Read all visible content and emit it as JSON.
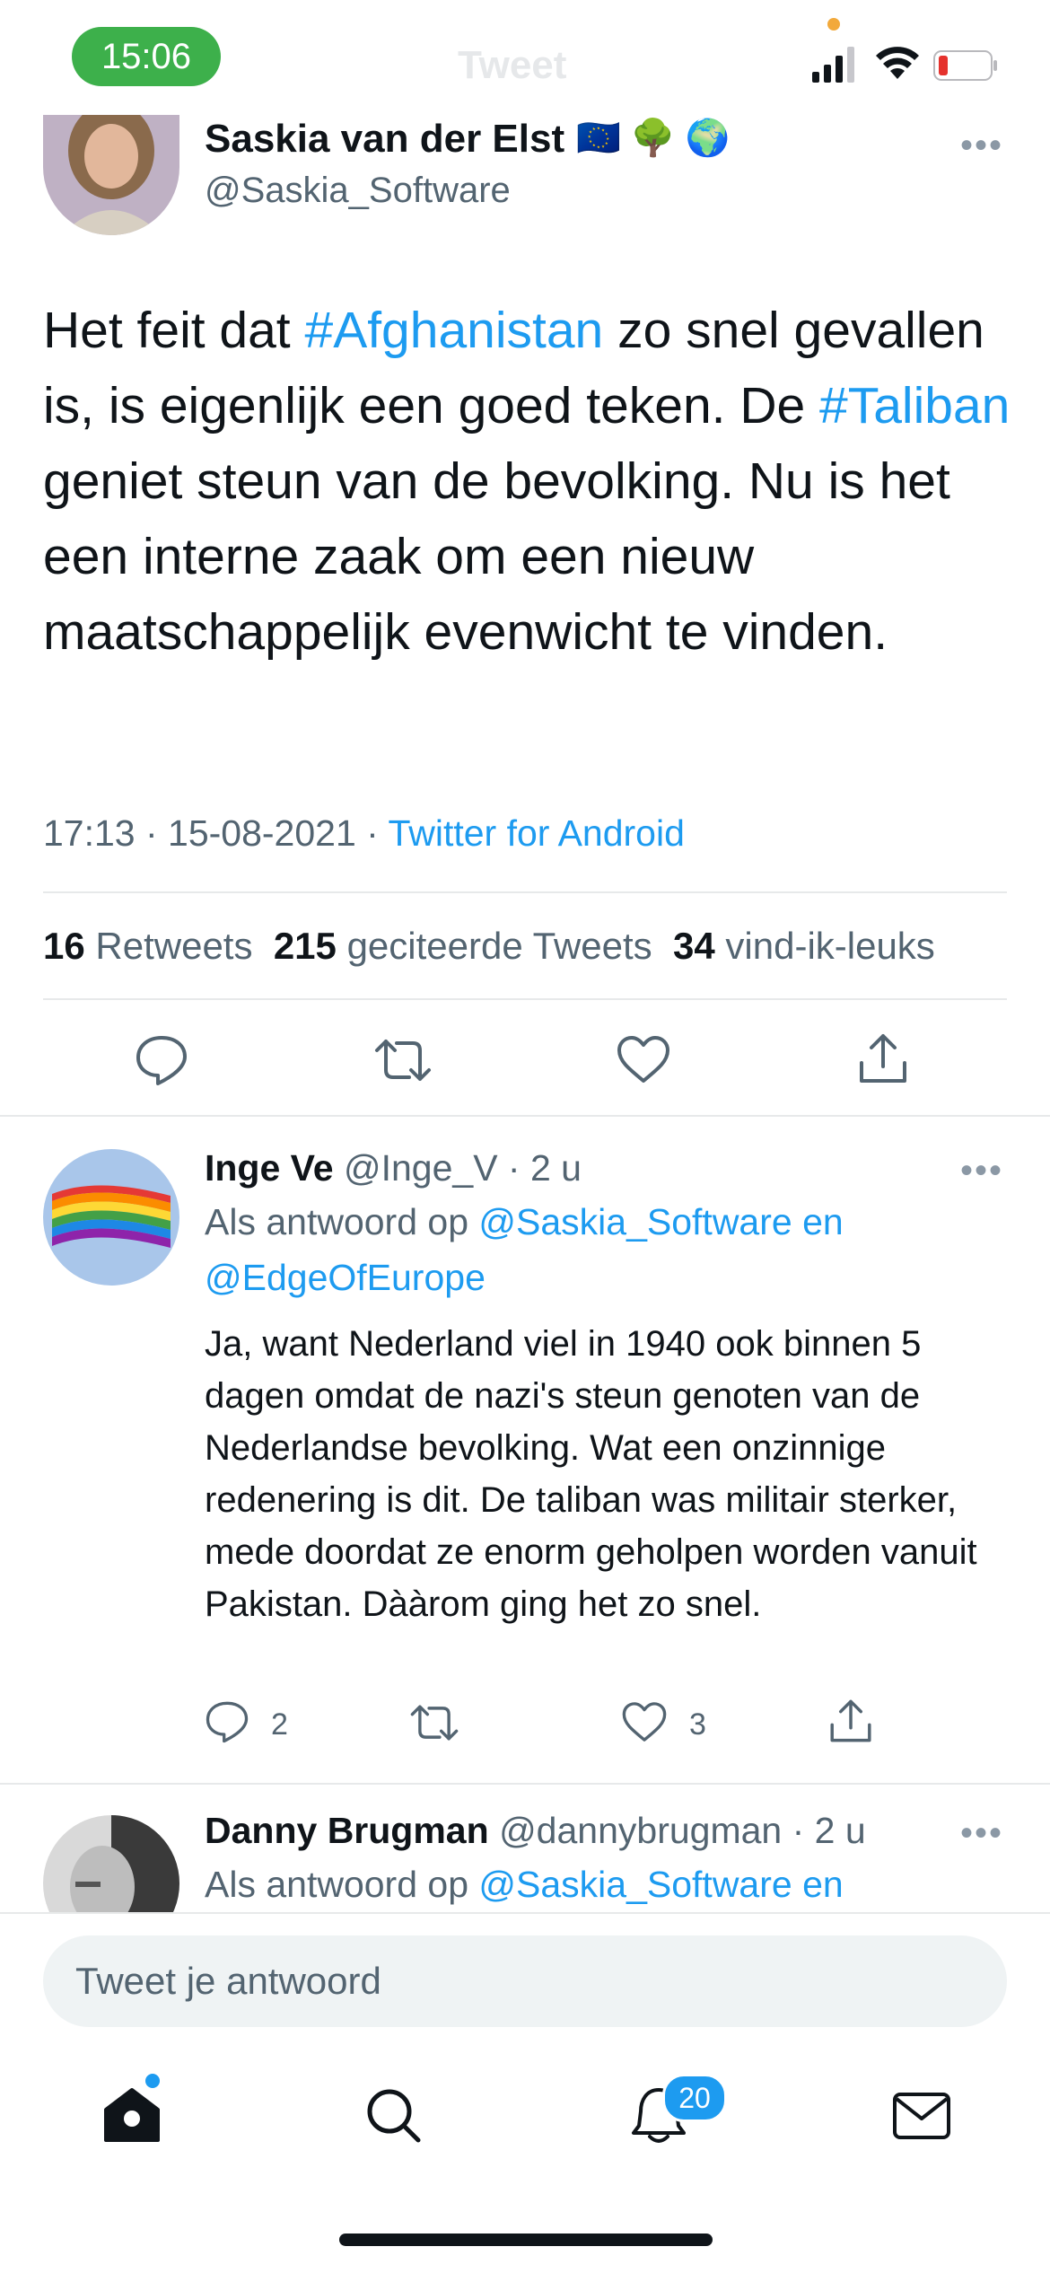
{
  "status_bar": {
    "time": "15:06"
  },
  "nav": {
    "title_ghost": "Tweet"
  },
  "main_tweet": {
    "author_name": "Saskia van der Elst",
    "author_emoji": "🇪🇺 🌳 🌍",
    "handle": "@Saskia_Software",
    "text_parts": [
      "Het feit dat ",
      "#Afghanistan",
      " zo snel gevallen is, is eigenlijk een goed teken. De ",
      "#Taliban",
      " geniet steun van de bevolking. Nu is het een interne zaak om een nieuw maatschappelijk evenwicht te vinden."
    ],
    "timestamp": "17:13 · 15-08-2021 · ",
    "source": "Twitter for Android",
    "stats": {
      "retweets_count": "16",
      "retweets_label": "Retweets",
      "quotes_count": "215",
      "quotes_label": "geciteerde Tweets",
      "likes_count": "34",
      "likes_label": "vind-ik-leuks"
    }
  },
  "replies": [
    {
      "author_name": "Inge Ve",
      "handle_time": "@Inge_V · 2 u",
      "reply_prefix": "Als antwoord op ",
      "reply_to": "@Saskia_Software en",
      "reply_to_2": "@EdgeOfEurope",
      "text": "Ja, want Nederland viel in 1940 ook binnen 5 dagen omdat de nazi's steun genoten van de Nederlandse bevolking. Wat een onzinnige redenering is dit. De taliban was militair sterker, mede doordat ze enorm geholpen worden vanuit Pakistan. Dààrom ging het zo snel.",
      "reply_count": "2",
      "like_count": "3"
    },
    {
      "author_name": "Danny Brugman",
      "handle_time": "@dannybrugman · 2 u",
      "reply_prefix": "Als antwoord op ",
      "reply_to": "@Saskia_Software en"
    }
  ],
  "compose": {
    "placeholder": "Tweet je antwoord"
  },
  "tabbar": {
    "notifications_badge": "20"
  },
  "colors": {
    "accent": "#1d9bf0",
    "muted": "#536471",
    "time_pill": "#3db04b"
  }
}
